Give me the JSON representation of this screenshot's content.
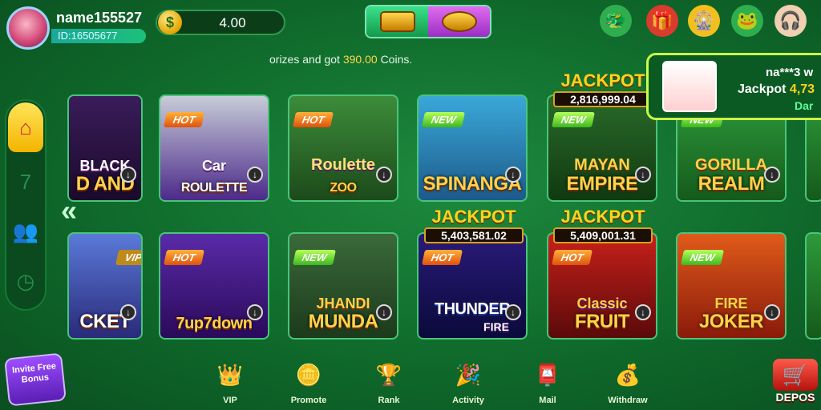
{
  "user": {
    "name": "name155527",
    "id": "ID:16505677"
  },
  "balance": {
    "symbol": "$",
    "value": "4.00"
  },
  "ticker": {
    "prefix": "orizes and got",
    "amount": "390.00",
    "suffix": "Coins."
  },
  "notification": {
    "user": "na***3 w",
    "prefix": "Jackpot",
    "amount": "4,73",
    "game": "Dar"
  },
  "games": [
    {
      "title": "D AND",
      "sub": "BLACK",
      "badge": ""
    },
    {
      "title": "ROULETTE",
      "sub": "Car",
      "badge": "HOT"
    },
    {
      "title": "ZOO",
      "sub": "Roulette",
      "badge": "HOT"
    },
    {
      "title": "SPINANGA",
      "sub": "",
      "badge": "NEW"
    },
    {
      "title": "EMPIRE",
      "sub": "MAYAN",
      "badge": "NEW",
      "jackpot_label": "JACKPOT",
      "jackpot": "2,816,999.04"
    },
    {
      "title": "REALM",
      "sub": "GORILLA",
      "badge": "NEW"
    },
    {
      "title": "CKET",
      "sub": "",
      "badge": "",
      "vip": "VIP"
    },
    {
      "title": "7up7down",
      "sub": "",
      "badge": "HOT"
    },
    {
      "title": "MUNDA",
      "sub": "JHANDI",
      "badge": "NEW"
    },
    {
      "title": "THUNDER",
      "sub": "FIRE",
      "badge": "HOT",
      "jackpot_label": "JACKPOT",
      "jackpot": "5,403,581.02"
    },
    {
      "title": "FRUIT",
      "sub": "Classic",
      "badge": "HOT",
      "jackpot_label": "JACKPOT",
      "jackpot": "5,409,001.31"
    },
    {
      "title": "JOKER",
      "sub": "FIRE",
      "badge": "NEW"
    }
  ],
  "bottom_nav": {
    "invite": "Invite Free Bonus",
    "items": [
      "VIP",
      "Promote",
      "Rank",
      "Activity",
      "Mail",
      "Withdraw"
    ],
    "deposit": "DEPOS"
  },
  "colors": {
    "accent": "#ffd21e",
    "bg": "#0f6a2b",
    "hot": "#e0520c",
    "new": "#3cb81e"
  }
}
